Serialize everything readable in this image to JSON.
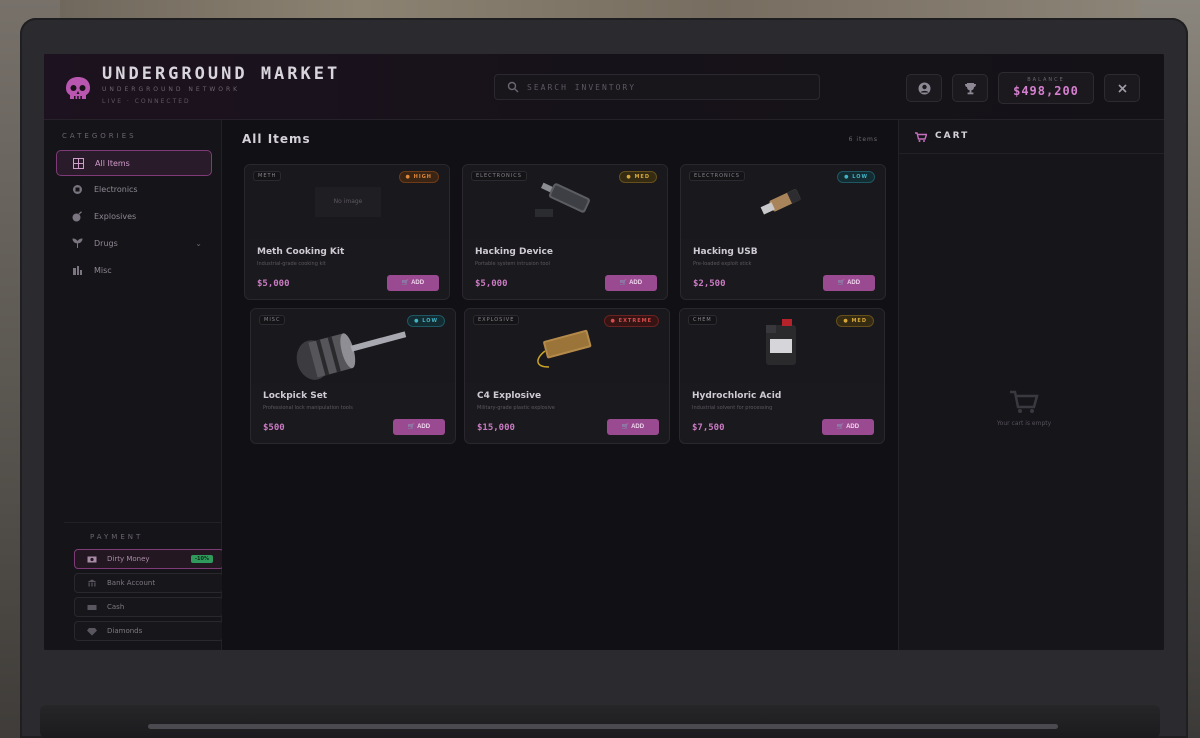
{
  "header": {
    "title": "UNDERGROUND MARKET",
    "subtitle": "UNDERGROUND NETWORK",
    "status": "LIVE · CONNECTED",
    "search_placeholder": "SEARCH INVENTORY",
    "balance_label": "BALANCE",
    "balance": "$498,200"
  },
  "sidebar": {
    "title": "CATEGORIES",
    "categories": [
      {
        "label": "All Items",
        "icon": "grid-icon",
        "active": true
      },
      {
        "label": "Electronics",
        "icon": "chip-icon"
      },
      {
        "label": "Explosives",
        "icon": "bomb-icon"
      },
      {
        "label": "Drugs",
        "icon": "leaf-icon"
      },
      {
        "label": "Misc",
        "icon": "misc-icon"
      }
    ],
    "payment_title": "PAYMENT",
    "payments": [
      {
        "label": "Dirty Money",
        "badge": "-10%",
        "active": true
      },
      {
        "label": "Bank Account"
      },
      {
        "label": "Cash"
      },
      {
        "label": "Diamonds"
      }
    ]
  },
  "main": {
    "title": "All Items",
    "count": "6 items",
    "no_image": "No image",
    "add_label": "ADD",
    "items": [
      {
        "tag": "METH",
        "risk": "HIGH",
        "name": "Meth Cooking Kit",
        "desc": "Industrial-grade cooking kit",
        "price": "$5,000"
      },
      {
        "tag": "ELECTRONICS",
        "risk": "MED",
        "name": "Hacking Device",
        "desc": "Portable system intrusion tool",
        "price": "$5,000"
      },
      {
        "tag": "ELECTRONICS",
        "risk": "LOW",
        "name": "Hacking USB",
        "desc": "Pre-loaded exploit stick",
        "price": "$2,500"
      },
      {
        "tag": "MISC",
        "risk": "LOW",
        "name": "Lockpick Set",
        "desc": "Professional lock manipulation tools",
        "price": "$500"
      },
      {
        "tag": "EXPLOSIVE",
        "risk": "EXTREME",
        "name": "C4 Explosive",
        "desc": "Military-grade plastic explosive",
        "price": "$15,000"
      },
      {
        "tag": "CHEM",
        "risk": "MED",
        "name": "Hydrochloric Acid",
        "desc": "Industrial solvent for processing",
        "price": "$7,500"
      }
    ]
  },
  "cart": {
    "title": "CART",
    "empty_text": "Your cart is empty"
  },
  "colors": {
    "accent": "#9a4a91",
    "accent_text": "#c97ac2",
    "risk_high": "#e08a3c",
    "risk_med": "#d6a83a",
    "risk_low": "#43b3c7",
    "risk_extreme": "#d84c4c"
  }
}
